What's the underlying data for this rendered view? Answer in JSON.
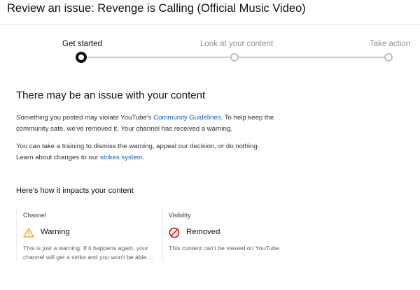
{
  "header": {
    "title": "Review an issue: Revenge is Calling (Official Music Video)"
  },
  "stepper": {
    "steps": [
      {
        "label": "Get started",
        "state": "active"
      },
      {
        "label": "Look at your content",
        "state": "inactive"
      },
      {
        "label": "Take action",
        "state": "inactive"
      }
    ]
  },
  "main": {
    "heading": "There may be an issue with your content",
    "para1": {
      "before": "Something you posted may violate YouTube's ",
      "link": "Community Guidelines",
      "after": ". To help keep the community safe, we've removed it. Your channel has received a warning."
    },
    "para2": {
      "before": "You can take a training to dismiss the warning, appeal our decision, or do nothing. Learn about changes to our ",
      "link": "strikes system",
      "after": "."
    }
  },
  "impact": {
    "title": "Here's how it impacts your content",
    "cards": [
      {
        "label": "Channel",
        "icon": "warning-icon",
        "status": "Warning",
        "description": "This is just a warning. If it happens again, your channel will get a strike and you won't be able ..."
      },
      {
        "label": "Visibility",
        "icon": "removed-icon",
        "status": "Removed",
        "description": "This content can't be viewed on YouTube."
      }
    ]
  },
  "colors": {
    "link": "#065fd4",
    "warning": "#f9a825",
    "removed": "#cc0000",
    "step_active": "#0f0f0f",
    "step_inactive": "#bdbdbd"
  }
}
